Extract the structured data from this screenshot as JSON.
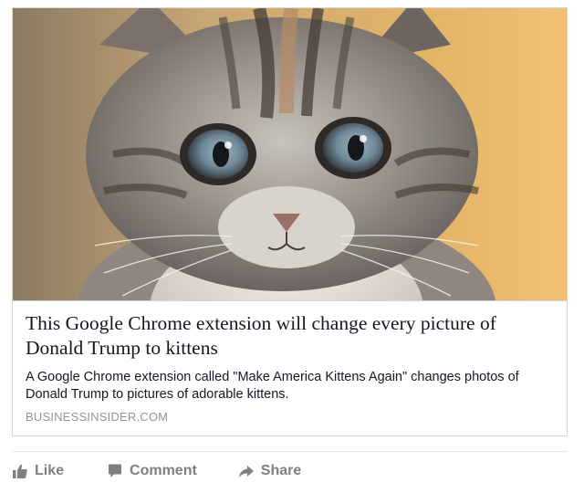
{
  "post": {
    "link": {
      "image_subject": "tabby kitten face close-up",
      "headline": "This Google Chrome extension will change every picture of Donald Trump to kittens",
      "summary": "A Google Chrome extension called \"Make America Kittens Again\" changes photos of Donald Trump to pictures of adorable kittens.",
      "domain": "BUSINESSINSIDER.COM"
    },
    "actions": {
      "like_label": "Like",
      "comment_label": "Comment",
      "share_label": "Share"
    },
    "icons": {
      "like": "thumbs-up-icon",
      "comment": "speech-bubble-icon",
      "share": "share-arrow-icon"
    },
    "colors": {
      "action_text": "#7f7f7f",
      "headline_text": "#141823",
      "domain_text": "#90949c",
      "card_border": "#d3d6db"
    }
  }
}
